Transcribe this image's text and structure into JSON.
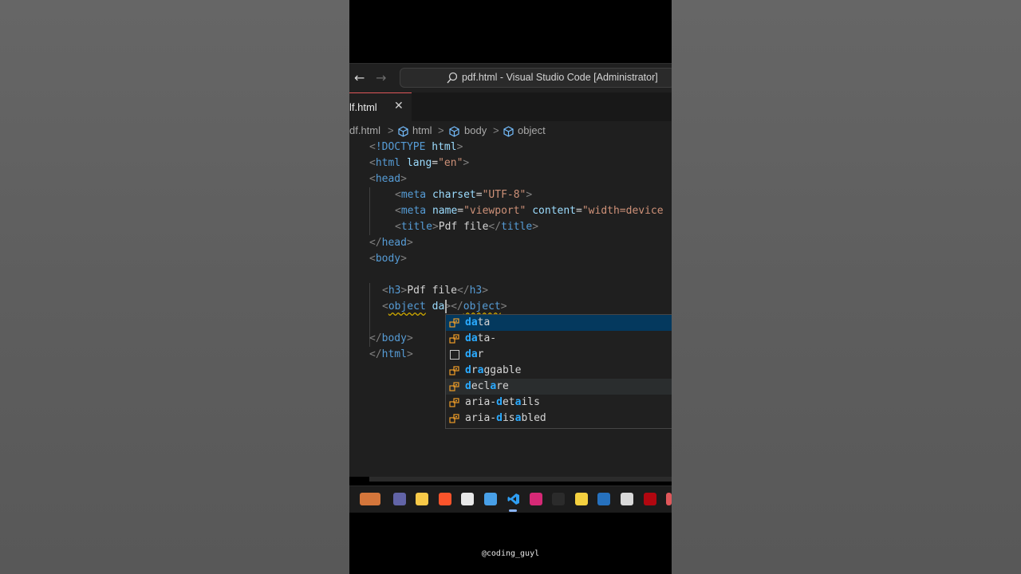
{
  "window": {
    "title": "pdf.html - Visual Studio Code [Administrator]",
    "nav_back": "←",
    "nav_forward": "→"
  },
  "tab": {
    "label": "lf.html",
    "close": "✕"
  },
  "breadcrumb": {
    "file": "df.html",
    "items": [
      "html",
      "body",
      "object"
    ],
    "separator": ">"
  },
  "code_lines": [
    "<!DOCTYPE html>",
    "<html lang=\"en\">",
    "<head>",
    "<meta charset=\"UTF-8\">",
    "<meta name=\"viewport\" content=\"width=device",
    "<title>Pdf file</title>",
    "</head>",
    "<body>",
    "",
    "<h3>Pdf file</h3>",
    "<object da></object>",
    "",
    "</body>",
    "</html>"
  ],
  "suggestions": [
    {
      "label": "data",
      "match": "da",
      "icon": "property-icon"
    },
    {
      "label": "data-",
      "match": "da",
      "icon": "property-icon"
    },
    {
      "label": "dar",
      "match": "da",
      "icon": "snippet-box-icon"
    },
    {
      "label": "draggable",
      "match": "d,a",
      "icon": "property-icon"
    },
    {
      "label": "declare",
      "match": "d,a",
      "icon": "property-icon"
    },
    {
      "label": "aria-details",
      "match": "d,a",
      "icon": "property-icon"
    },
    {
      "label": "aria-disabled",
      "match": "d,a",
      "icon": "property-icon"
    }
  ],
  "taskbar_icons": [
    "widgets-icon",
    "teams-chat-icon",
    "file-explorer-icon",
    "brave-icon",
    "store-icon",
    "notepad-icon",
    "vscode-icon",
    "instagram-icon",
    "terminal-icon",
    "sticky-notes-icon",
    "powershell-icon",
    "chrome-icon",
    "netflix-icon",
    "app-icon"
  ],
  "watermark": "@coding_guyl",
  "colors": {
    "tag": "#569cd6",
    "attribute": "#9cdcfe",
    "string": "#ce9178",
    "match_highlight": "#2aaaff",
    "tab_accent": "#e0575a"
  }
}
